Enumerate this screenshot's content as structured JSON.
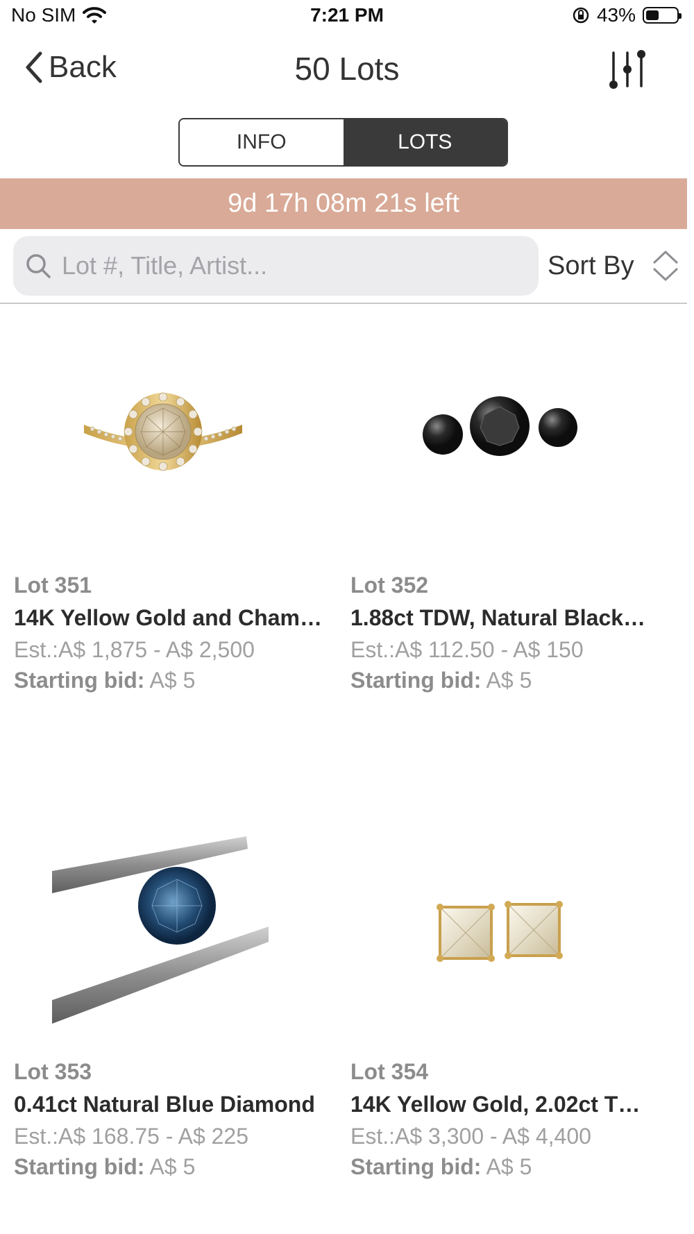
{
  "status_bar": {
    "carrier": "No SIM",
    "time": "7:21 PM",
    "battery": "43%",
    "battery_level": 0.43
  },
  "nav": {
    "back_label": "Back",
    "title": "50 Lots"
  },
  "segments": {
    "info": "INFO",
    "lots": "LOTS",
    "selected": "LOTS"
  },
  "timer": "9d 17h 08m 21s left",
  "search": {
    "placeholder": "Lot #, Title, Artist...",
    "value": ""
  },
  "sort_label": "Sort By",
  "lots": [
    {
      "lot": "Lot 351",
      "title": "14K Yellow Gold and Cham…",
      "estimate": "Est.:A$ 1,875 - A$ 2,500",
      "starting_label": "Starting bid:",
      "starting_value": "A$ 5",
      "image": "gold-halo-ring"
    },
    {
      "lot": "Lot 352",
      "title": "1.88ct TDW, Natural Black…",
      "estimate": "Est.:A$ 112.50 - A$ 150",
      "starting_label": "Starting bid:",
      "starting_value": "A$ 5",
      "image": "black-diamonds"
    },
    {
      "lot": "Lot 353",
      "title": "0.41ct Natural Blue Diamond",
      "estimate": "Est.:A$ 168.75 - A$ 225",
      "starting_label": "Starting bid:",
      "starting_value": "A$ 5",
      "image": "blue-diamond-tweezers"
    },
    {
      "lot": "Lot 354",
      "title": "14K Yellow Gold, 2.02ct T…",
      "estimate": "Est.:A$ 3,300 - A$ 4,400",
      "starting_label": "Starting bid:",
      "starting_value": "A$ 5",
      "image": "princess-cut-earrings"
    }
  ]
}
